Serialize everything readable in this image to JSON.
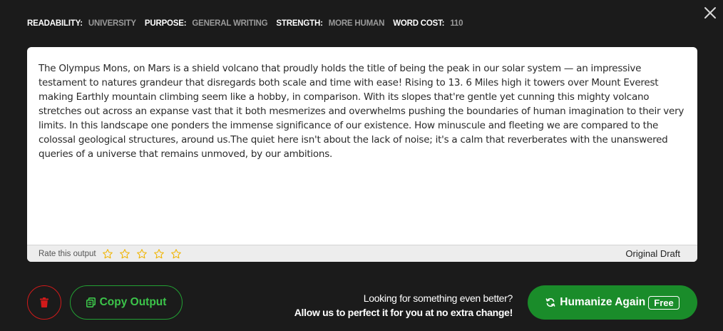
{
  "meta": {
    "items": [
      {
        "key": "READABILITY:",
        "value": "UNIVERSITY"
      },
      {
        "key": "PURPOSE:",
        "value": "GENERAL WRITING"
      },
      {
        "key": "STRENGTH:",
        "value": "MORE HUMAN"
      },
      {
        "key": "WORD COST:",
        "value": "110"
      }
    ]
  },
  "icons": {
    "close": "close-icon",
    "star": "star-outline-icon",
    "delete": "trash-icon",
    "copy": "copy-icon",
    "refresh": "refresh-icon"
  },
  "output": {
    "text": "The Olympus Mons, on Mars is a shield volcano that proudly holds the title of being the peak in our solar system — an impressive testament to natures grandeur that disregards both scale and time with ease! Rising to 13. 6 Miles high it towers over Mount Everest making Earthly mountain climbing seem like a hobby, in comparison. With its slopes that're gentle yet cunning this mighty volcano stretches out across an expanse vast that it both mesmerizes and overwhelms pushing the boundaries of human imagination to their very limits. In this landscape one ponders the immense significance of our existence. How minuscule and fleeting we are compared to the colossal geological structures, around us.The quiet here isn't about the lack of noise; it's a calm that reverberates with the unanswered queries of a universe that remains unmoved, by our ambitions."
  },
  "rating": {
    "label": "Rate this output",
    "max_stars": 5,
    "selected": 0
  },
  "draft": {
    "label": "Original Draft"
  },
  "actions": {
    "copy_label": "Copy Output",
    "promo_line1": "Looking for something even better?",
    "promo_line2": "Allow us to perfect it for you at no extra change!",
    "humanize_label": "Humanize Again",
    "free_badge": "Free"
  },
  "colors": {
    "background": "#1b1b1b",
    "accent_green": "#1a8c2a",
    "copy_green": "#3cc44a",
    "delete_red": "#d11a1a",
    "star_yellow": "#f0b400",
    "meta_value": "#9a9a9a"
  }
}
